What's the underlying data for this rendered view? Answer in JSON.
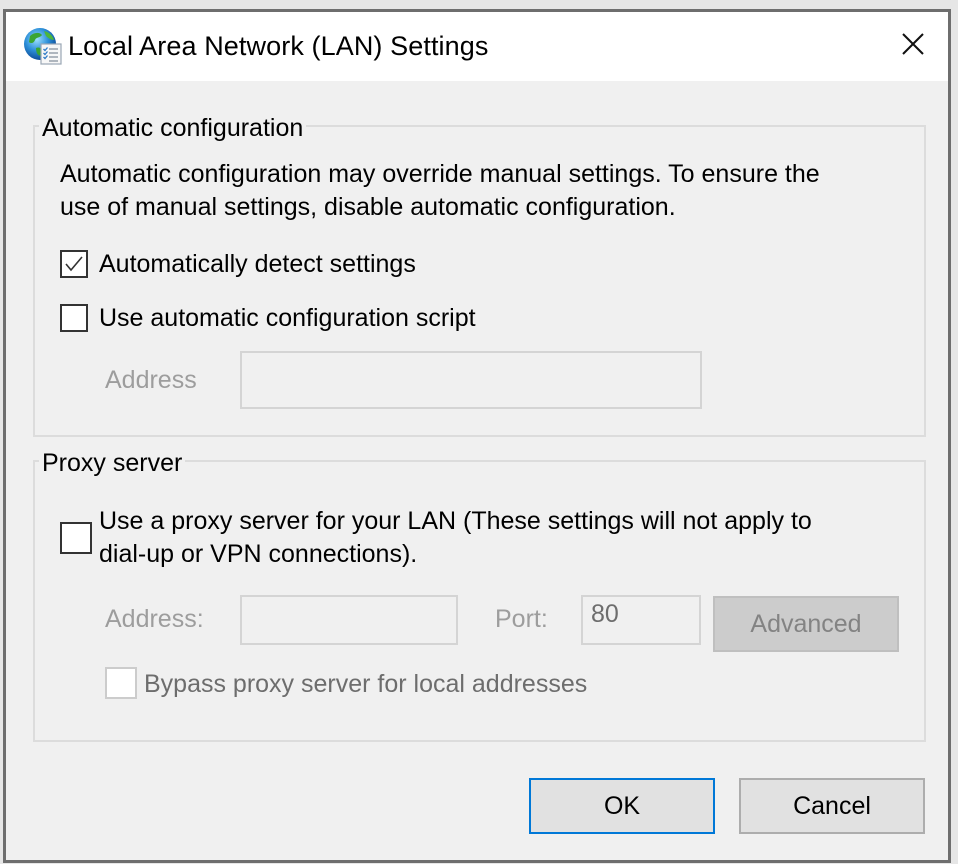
{
  "window": {
    "title": "Local Area Network (LAN) Settings",
    "icon": "globe-checklist-icon",
    "close_icon": "close-icon"
  },
  "automatic_configuration": {
    "legend": "Automatic configuration",
    "description_line1": "Automatic configuration may override manual settings.  To ensure the",
    "description_line2": "use of manual settings, disable automatic configuration.",
    "auto_detect": {
      "label": "Automatically detect settings",
      "checked": true,
      "enabled": true
    },
    "use_script": {
      "label": "Use automatic configuration script",
      "checked": false,
      "enabled": true
    },
    "address": {
      "label": "Address",
      "value": "",
      "enabled": false
    }
  },
  "proxy_server": {
    "legend": "Proxy server",
    "use_proxy": {
      "label_line1": "Use a proxy server for your LAN (These settings will not apply to",
      "label_line2": "dial-up or VPN connections).",
      "checked": false,
      "enabled": true
    },
    "address": {
      "label": "Address:",
      "value": "",
      "enabled": false
    },
    "port": {
      "label": "Port:",
      "value": "80",
      "enabled": false
    },
    "advanced_button": {
      "label": "Advanced",
      "enabled": false
    },
    "bypass_local": {
      "label": "Bypass proxy server for local addresses",
      "checked": false,
      "enabled": false
    }
  },
  "buttons": {
    "ok": "OK",
    "cancel": "Cancel"
  },
  "colors": {
    "accent": "#0078d7",
    "dialog_bg": "#f0f0f0",
    "disabled_text": "#9d9d9d",
    "frame": "#6e6e6e"
  }
}
